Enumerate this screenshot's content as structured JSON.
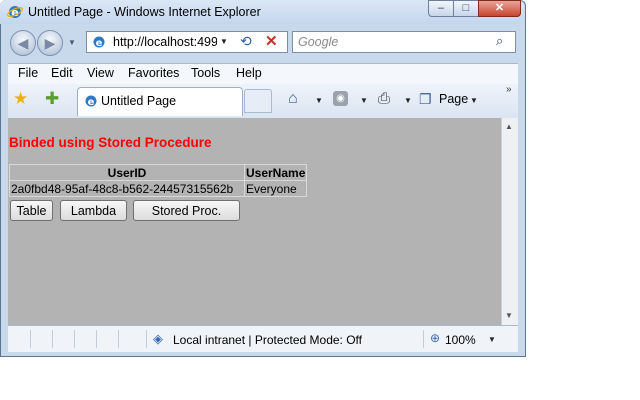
{
  "window": {
    "title": "Untitled Page - Windows Internet Explorer",
    "controls": {
      "minimize": "–",
      "maximize": "□",
      "close": "✕"
    }
  },
  "nav": {
    "address": "http://localhost:499",
    "search_placeholder": "Google"
  },
  "menu": [
    "File",
    "Edit",
    "View",
    "Favorites",
    "Tools",
    "Help"
  ],
  "tab": {
    "label": "Untitled Page"
  },
  "toolbar": {
    "page_label": "Page",
    "more": "»"
  },
  "content": {
    "heading": "Binded using Stored Procedure",
    "grid": {
      "columns": [
        "UserID",
        "UserName"
      ],
      "rows": [
        [
          "2a0fbd48-95af-48c8-b562-24457315562b",
          "Everyone"
        ]
      ]
    },
    "buttons": {
      "table": "Table",
      "lambda": "Lambda",
      "stored_proc": "Stored Proc."
    }
  },
  "status": {
    "zone_text": "Local intranet | Protected Mode: Off",
    "zoom": "100%"
  },
  "icons": {
    "back": "◀",
    "forward": "▶",
    "refresh": "⟲",
    "stop": "✕",
    "search": "⌕",
    "favorites": "★",
    "add_favorites": "✚",
    "home": "⌂",
    "feeds": "◉",
    "print": "⎙",
    "page": "❐",
    "zone": "◈",
    "zoom": "⊕",
    "dropdown": "▼",
    "up": "▲"
  },
  "colors": {
    "heading": "#ff0000",
    "content_bg": "#b3b3b3"
  }
}
